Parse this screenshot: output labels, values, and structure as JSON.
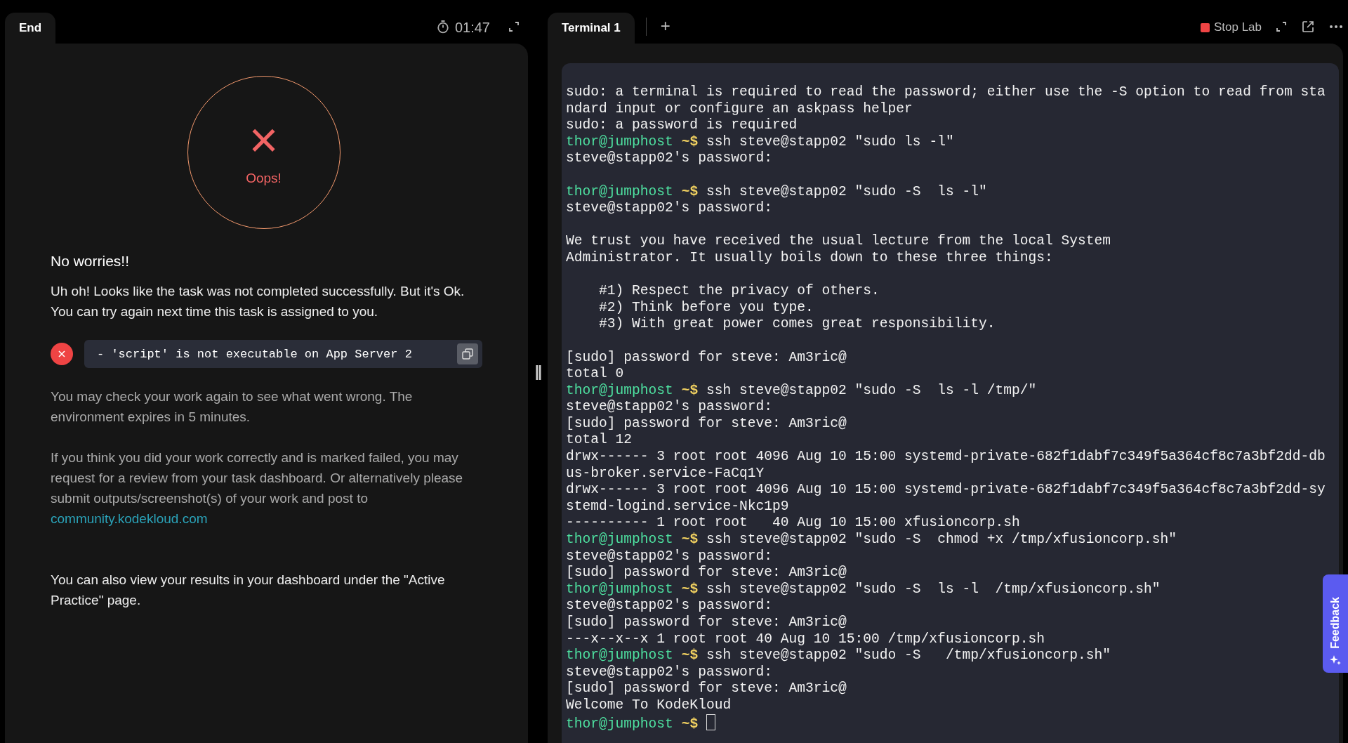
{
  "left_pane": {
    "tab": {
      "label": "End",
      "selected": true
    },
    "timer": "01:47",
    "result": {
      "icon": "×",
      "label": "Oops!"
    },
    "heading": "No worries!!",
    "message": "Uh oh! Looks like the task was not completed successfully. But it's Ok. You can try again next time this task is assigned to you.",
    "checks": [
      {
        "passed": false,
        "text": "- 'script' is not executable on App Server 2"
      }
    ],
    "info": [
      "You may check your work again to see what went wrong. The environment expires in 5 minutes.",
      "If you think you did your work correctly and is marked failed, you may request for a review from your task dashboard. Or alternatively please submit outputs/screenshot(s) of your work and post to"
    ],
    "link": "community.kodekloud.com",
    "footer": "You can also view your results in your dashboard under the \"Active Practice\" page."
  },
  "splitter": "||",
  "right_pane": {
    "tabs": [
      {
        "label": "Terminal 1",
        "selected": true
      }
    ],
    "add_tab": "+",
    "stop_button": "Stop Lab",
    "terminal": [
      {
        "kind": "output",
        "text": "sudo: a terminal is required to read the password; either use the -S option to read from sta"
      },
      {
        "kind": "output",
        "text": "ndard input or configure an askpass helper"
      },
      {
        "kind": "output",
        "text": "sudo: a password is required"
      },
      {
        "kind": "prompt",
        "prompt": "thor@jumphost",
        "dir": "~$",
        "command": "ssh steve@stapp02 \"sudo ls -l\""
      },
      {
        "kind": "output",
        "text": "steve@stapp02's password:"
      },
      {
        "kind": "blank"
      },
      {
        "kind": "prompt",
        "prompt": "thor@jumphost",
        "dir": "~$",
        "command": "ssh steve@stapp02 \"sudo -S  ls -l\""
      },
      {
        "kind": "output",
        "text": "steve@stapp02's password:"
      },
      {
        "kind": "blank"
      },
      {
        "kind": "output",
        "text": "We trust you have received the usual lecture from the local System"
      },
      {
        "kind": "output",
        "text": "Administrator. It usually boils down to these three things:"
      },
      {
        "kind": "blank"
      },
      {
        "kind": "output",
        "text": "    #1) Respect the privacy of others."
      },
      {
        "kind": "output",
        "text": "    #2) Think before you type."
      },
      {
        "kind": "output",
        "text": "    #3) With great power comes great responsibility."
      },
      {
        "kind": "blank"
      },
      {
        "kind": "output",
        "text": "[sudo] password for steve: Am3ric@"
      },
      {
        "kind": "output",
        "text": "total 0"
      },
      {
        "kind": "prompt",
        "prompt": "thor@jumphost",
        "dir": "~$",
        "command": "ssh steve@stapp02 \"sudo -S  ls -l /tmp/\""
      },
      {
        "kind": "output",
        "text": "steve@stapp02's password:"
      },
      {
        "kind": "output",
        "text": "[sudo] password for steve: Am3ric@"
      },
      {
        "kind": "output",
        "text": "total 12"
      },
      {
        "kind": "output",
        "text": "drwx------ 3 root root 4096 Aug 10 15:00 systemd-private-682f1dabf7c349f5a364cf8c7a3bf2dd-db"
      },
      {
        "kind": "output",
        "text": "us-broker.service-FaCq1Y"
      },
      {
        "kind": "output",
        "text": "drwx------ 3 root root 4096 Aug 10 15:00 systemd-private-682f1dabf7c349f5a364cf8c7a3bf2dd-sy"
      },
      {
        "kind": "output",
        "text": "stemd-logind.service-Nkc1p9"
      },
      {
        "kind": "output",
        "text": "---------- 1 root root   40 Aug 10 15:00 xfusioncorp.sh"
      },
      {
        "kind": "prompt",
        "prompt": "thor@jumphost",
        "dir": "~$",
        "command": "ssh steve@stapp02 \"sudo -S  chmod +x /tmp/xfusioncorp.sh\""
      },
      {
        "kind": "output",
        "text": "steve@stapp02's password:"
      },
      {
        "kind": "output",
        "text": "[sudo] password for steve: Am3ric@"
      },
      {
        "kind": "prompt",
        "prompt": "thor@jumphost",
        "dir": "~$",
        "command": "ssh steve@stapp02 \"sudo -S  ls -l  /tmp/xfusioncorp.sh\""
      },
      {
        "kind": "output",
        "text": "steve@stapp02's password:"
      },
      {
        "kind": "output",
        "text": "[sudo] password for steve: Am3ric@"
      },
      {
        "kind": "output",
        "text": "---x--x--x 1 root root 40 Aug 10 15:00 /tmp/xfusioncorp.sh"
      },
      {
        "kind": "prompt",
        "prompt": "thor@jumphost",
        "dir": "~$",
        "command": "ssh steve@stapp02 \"sudo -S   /tmp/xfusioncorp.sh\""
      },
      {
        "kind": "output",
        "text": "steve@stapp02's password:"
      },
      {
        "kind": "output",
        "text": "[sudo] password for steve: Am3ric@"
      },
      {
        "kind": "output",
        "text": "Welcome To KodeKloud"
      },
      {
        "kind": "prompt",
        "prompt": "thor@jumphost",
        "dir": "~$",
        "cursor": true
      }
    ]
  },
  "feedback_tab": "Feedback"
}
